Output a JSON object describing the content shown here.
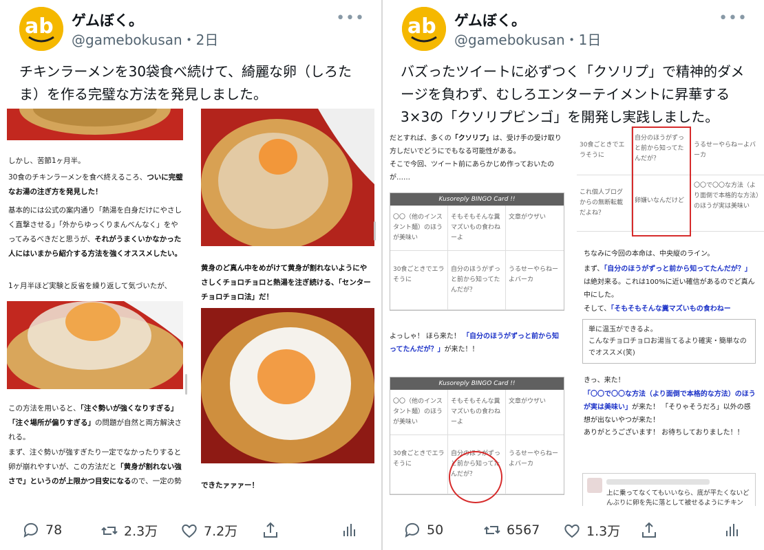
{
  "left": {
    "author_name": "ゲムぼく。",
    "handle": "@gamebokusan",
    "time": "・2日",
    "more": "•••",
    "text": "チキンラーメンを30袋食べ続けて、綺麗な卵（しろたま）を作る完璧な方法を発見しました。",
    "article": {
      "p1": "しかし、苦節1ヶ月半。",
      "p2_a": "30食のチキンラーメンを食べ終えるころ、",
      "p2_b": "ついに完璧なお湯の注ぎ方を発見した！",
      "p3_a": "基本的には公式の案内通り「熱湯を白身だけにやさしく直撃させる」「外からゆっくりまんべんなく」をやってみるべきだと思うが、",
      "p3_b": "それがうまくいかなかった人にはいまから紹介する方法を強くオススメしたい。",
      "p4": "1ヶ月半ほど実験と反省を繰り返して気づいたが、",
      "p5_a": "この方法を用いると、",
      "p5_b": "「注ぐ勢いが強くなりすぎる」「注ぐ場所が偏りすぎる」",
      "p5_c": "の問題が自然と両方解決される。",
      "p6_a": "まず、注ぐ勢いが強すぎたり一定でなかったりすると卵が崩れやすいが、この方法だと",
      "p6_b": "「黄身が割れない強さで」というのが上限かつ目安になる",
      "p6_c": "ので、一定の勢いで注ぎ続けられる。",
      "cap1": "黄身のど真ん中をめがけて黄身が割れないようにやさしくチョロチョロと熱湯を注ぎ続ける、「センターチョロチョロ法」だ！",
      "cap2": "できたァァァー！"
    },
    "stats": {
      "replies": "78",
      "retweets": "2.3万",
      "likes": "7.2万"
    }
  },
  "right": {
    "author_name": "ゲムぼく。",
    "handle": "@gamebokusan",
    "time": "・1日",
    "more": "•••",
    "text": "バズったツイートに必ずつく「クソリプ」で精神的ダメージを負わず、むしろエンターテイメントに昇華する3×3の「クソリプビンゴ」を開発し実践しました。",
    "article": {
      "intro_a": "だとすれば、多くの",
      "intro_b": "「クソリプ」",
      "intro_c": "は、受け手の受け取り方しだいでどうにでもなる可能性がある。",
      "intro2": "そこで今回、ツイート前にあらかじめ作っておいたのが……",
      "bingo_title": "Kusoreply BINGO Card !!",
      "cells": [
        "〇〇（他のインスタント麺）のほうが美味い",
        "そもそもそんな糞マズいもの食わねーよ",
        "文章がウザい",
        "30食ごときでエラそうに",
        "自分のほうがずっと前から知ってたんだが？",
        "うるせーやらねーよバーカ"
      ],
      "cells2": [
        "30食ごときでエラそうに",
        "自分のほうがずっと前から知ってたんだが？",
        "うるせーやらねーよバーカ",
        "これ個人ブログからの無断転載だよね？",
        "卵嫌いなんだけど",
        "〇〇で〇〇な方法（より面倒で本格的な方法）のほうが実は美味い"
      ],
      "came1_a": "よっしゃ！ ほら来た！ ",
      "came1_b": "「自分のほうがずっと前から知ってたんだが？」",
      "came1_c": "が来た！！",
      "honmei_a": "ちなみに今回の本命は、中央縦のライン。",
      "honmei_b": "まず、",
      "honmei_c": "「自分のほうがずっと前から知ってたんだが？」",
      "honmei_d": "は絶対来る。これは100%に近い確信があるのでど真ん中にした。",
      "honmei_e": "そして、",
      "honmei_f": "「そもそもそんな糞マズいもの食わねー",
      "note1": "単に温玉ができるよ。",
      "note2": "こんなチョロチョロお湯当てるより確実・簡単なのでオススメ(笑)",
      "kita_a": "きっ、来た！",
      "kita_b": "「〇〇で〇〇な方法（より面倒で本格的な方法）のほうが実は美味い」",
      "kita_c": "が来た！ 「そりゃそうだろ」以外の感想が出ないやつが来た！",
      "kita_d": "ありがとうございます！ お待ちしておりました！！",
      "comment": "上に乗ってなくてもいいなら、底が平たくないどんぶりに卵を先に落として被せるようにチキン"
    },
    "stats": {
      "replies": "50",
      "retweets": "6567",
      "likes": "1.3万"
    }
  },
  "colors": {
    "avatar_bg": "#f5b800",
    "icon_gray": "#536471",
    "link_blue": "#1d33c8",
    "highlight_red": "#d62b2b"
  },
  "icons": [
    "reply-icon",
    "retweet-icon",
    "like-icon",
    "share-icon",
    "analytics-icon",
    "more-icon"
  ]
}
